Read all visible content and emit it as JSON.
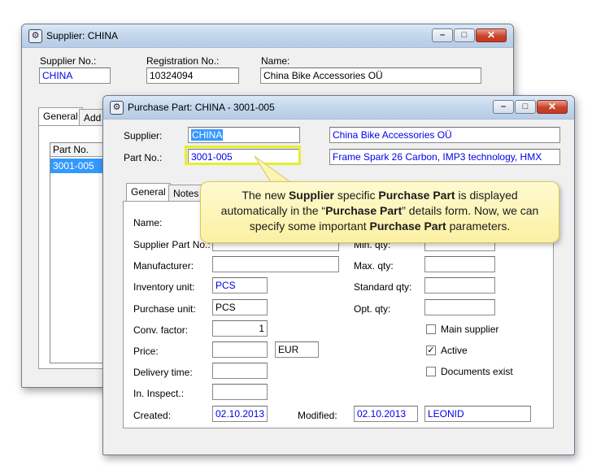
{
  "supplier_window": {
    "title": "Supplier: CHINA",
    "supplier_no_label": "Supplier No.:",
    "supplier_no": "CHINA",
    "registration_no_label": "Registration No.:",
    "registration_no": "10324094",
    "name_label": "Name:",
    "name": "China Bike Accessories OÜ",
    "tabs": [
      "General",
      "Add"
    ],
    "list_header": "Part No.",
    "list_rows": [
      "3001-005"
    ]
  },
  "part_window": {
    "title": "Purchase Part: CHINA - 3001-005",
    "supplier_label": "Supplier:",
    "supplier": "CHINA",
    "supplier_name": "China Bike Accessories OÜ",
    "part_no_label": "Part No.:",
    "part_no": "3001-005",
    "part_desc": "Frame Spark 26 Carbon, IMP3 technology, HMX",
    "tabs": [
      "General",
      "Notes"
    ],
    "name_label": "Name:",
    "supplier_part_no_label": "Supplier Part No.:",
    "manufacturer_label": "Manufacturer:",
    "inventory_unit_label": "Inventory unit:",
    "inventory_unit": "PCS",
    "purchase_unit_label": "Purchase unit:",
    "purchase_unit": "PCS",
    "conv_factor_label": "Conv. factor:",
    "conv_factor": "1",
    "price_label": "Price:",
    "price": "",
    "currency": "EUR",
    "delivery_time_label": "Delivery time:",
    "inspect_label": "In. Inspect.:",
    "created_label": "Created:",
    "created": "02.10.2013",
    "modified_label": "Modified:",
    "modified": "02.10.2013",
    "modified_by": "LEONID",
    "min_qty_label": "Min. qty:",
    "max_qty_label": "Max. qty:",
    "standard_qty_label": "Standard qty:",
    "opt_qty_label": "Opt. qty:",
    "main_supplier_label": "Main supplier",
    "main_supplier_checked": false,
    "active_label": "Active",
    "active_checked": true,
    "documents_exist_label": "Documents exist",
    "documents_exist_checked": false
  },
  "callout": {
    "t1": "The new ",
    "b1": "Supplier",
    "t2": " specific ",
    "b2": "Purchase Part",
    "t3": " is displayed automatically in the “",
    "b3": "Purchase Part",
    "t4": "” details form.  Now, we can specify some important ",
    "b4": "Purchase Part",
    "t5": " parameters."
  },
  "icons": {
    "window_icon": "gear-icon",
    "minimize": "minimize-icon",
    "maximize": "maximize-icon",
    "close": "close-icon"
  }
}
